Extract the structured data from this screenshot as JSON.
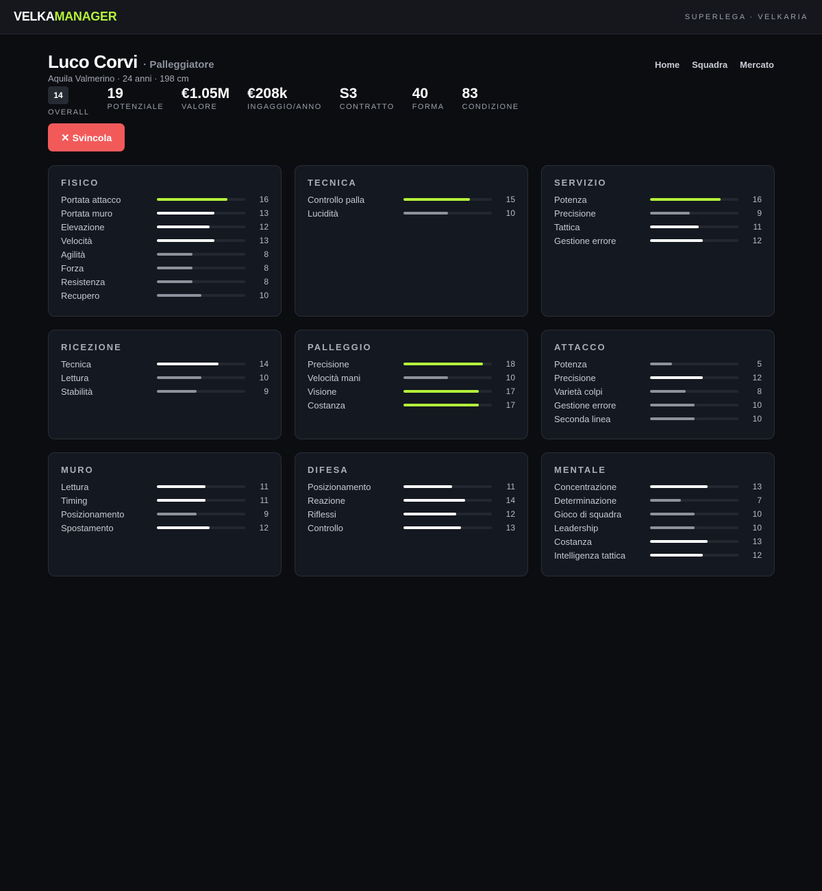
{
  "brand": {
    "part1": "VELKA",
    "part2": "MANAGER"
  },
  "league": "SUPERLEGA · VELKARIA",
  "nav": [
    "Home",
    "Squadra",
    "Mercato"
  ],
  "player": {
    "name": "Luco Corvi",
    "role": "· Palleggiatore",
    "subtitle": "Aquila Valmerino · 24 anni · 198 cm"
  },
  "overall": {
    "value": "14",
    "label": "OVERALL"
  },
  "stats": [
    {
      "value": "19",
      "label": "POTENZIALE"
    },
    {
      "value": "€1.05M",
      "label": "VALORE"
    },
    {
      "value": "€208k",
      "label": "INGAGGIO/ANNO"
    },
    {
      "value": "S3",
      "label": "CONTRATTO"
    },
    {
      "value": "40",
      "label": "FORMA"
    },
    {
      "value": "83",
      "label": "CONDIZIONE"
    }
  ],
  "release_button": {
    "icon": "close-icon",
    "label": "Svincola"
  },
  "attribute_max": 20,
  "colors": {
    "high": "#b4f33a",
    "mid": "#ffffff",
    "low": "#8d929d",
    "danger": "#f25a5a"
  },
  "cards": [
    {
      "title": "FISICO",
      "attrs": [
        {
          "name": "Portata attacco",
          "value": 16
        },
        {
          "name": "Portata muro",
          "value": 13
        },
        {
          "name": "Elevazione",
          "value": 12
        },
        {
          "name": "Velocità",
          "value": 13
        },
        {
          "name": "Agilità",
          "value": 8
        },
        {
          "name": "Forza",
          "value": 8
        },
        {
          "name": "Resistenza",
          "value": 8
        },
        {
          "name": "Recupero",
          "value": 10
        }
      ]
    },
    {
      "title": "TECNICA",
      "attrs": [
        {
          "name": "Controllo palla",
          "value": 15
        },
        {
          "name": "Lucidità",
          "value": 10
        }
      ]
    },
    {
      "title": "SERVIZIO",
      "attrs": [
        {
          "name": "Potenza",
          "value": 16
        },
        {
          "name": "Precisione",
          "value": 9
        },
        {
          "name": "Tattica",
          "value": 11
        },
        {
          "name": "Gestione errore",
          "value": 12
        }
      ]
    },
    {
      "title": "RICEZIONE",
      "attrs": [
        {
          "name": "Tecnica",
          "value": 14
        },
        {
          "name": "Lettura",
          "value": 10
        },
        {
          "name": "Stabilità",
          "value": 9
        }
      ]
    },
    {
      "title": "PALLEGGIO",
      "attrs": [
        {
          "name": "Precisione",
          "value": 18
        },
        {
          "name": "Velocità mani",
          "value": 10
        },
        {
          "name": "Visione",
          "value": 17
        },
        {
          "name": "Costanza",
          "value": 17
        }
      ]
    },
    {
      "title": "ATTACCO",
      "attrs": [
        {
          "name": "Potenza",
          "value": 5
        },
        {
          "name": "Precisione",
          "value": 12
        },
        {
          "name": "Varietà colpi",
          "value": 8
        },
        {
          "name": "Gestione errore",
          "value": 10
        },
        {
          "name": "Seconda linea",
          "value": 10
        }
      ]
    },
    {
      "title": "MURO",
      "attrs": [
        {
          "name": "Lettura",
          "value": 11
        },
        {
          "name": "Timing",
          "value": 11
        },
        {
          "name": "Posizionamento",
          "value": 9
        },
        {
          "name": "Spostamento",
          "value": 12
        }
      ]
    },
    {
      "title": "DIFESA",
      "attrs": [
        {
          "name": "Posizionamento",
          "value": 11
        },
        {
          "name": "Reazione",
          "value": 14
        },
        {
          "name": "Riflessi",
          "value": 12
        },
        {
          "name": "Controllo",
          "value": 13
        }
      ]
    },
    {
      "title": "MENTALE",
      "attrs": [
        {
          "name": "Concentrazione",
          "value": 13
        },
        {
          "name": "Determinazione",
          "value": 7
        },
        {
          "name": "Gioco di squadra",
          "value": 10
        },
        {
          "name": "Leadership",
          "value": 10
        },
        {
          "name": "Costanza",
          "value": 13
        },
        {
          "name": "Intelligenza tattica",
          "value": 12
        }
      ]
    }
  ]
}
